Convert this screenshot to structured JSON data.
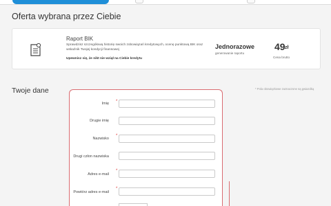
{
  "offer": {
    "heading": "Oferta wybrana przez Ciebie",
    "name": "Raport BIK",
    "description": "Sprawdzisz szczegółową historię swoich zobowiązań kredytowych, ocenę punktową BIK oraz wskaźnik Twojej kondycji finansowej",
    "note": "Upewnisz się, że nikt nie wziął na Ciebie kredytu",
    "frequency": "Jednorazowe",
    "frequency_sub": "generowanie raportu",
    "price": "49",
    "currency": "zł",
    "price_sub": "Cena brutto"
  },
  "form": {
    "title": "Twoje dane",
    "required_note": "* Pola obowiązkowe zaznaczone są gwiazdką",
    "fields": [
      {
        "label": "Imię",
        "required": "*",
        "value": ""
      },
      {
        "label": "Drugie imię",
        "required": "",
        "value": ""
      },
      {
        "label": "Nazwisko",
        "required": "*",
        "value": ""
      },
      {
        "label": "Drugi człon nazwiska",
        "required": "",
        "value": ""
      },
      {
        "label": "Adres e-mail",
        "required": "*",
        "value": ""
      },
      {
        "label": "Powtórz adres e-mail",
        "required": "*",
        "value": ""
      }
    ]
  },
  "colors": {
    "accent": "#1f8fd8",
    "error_border": "#d96b70",
    "required": "#dd3333"
  }
}
